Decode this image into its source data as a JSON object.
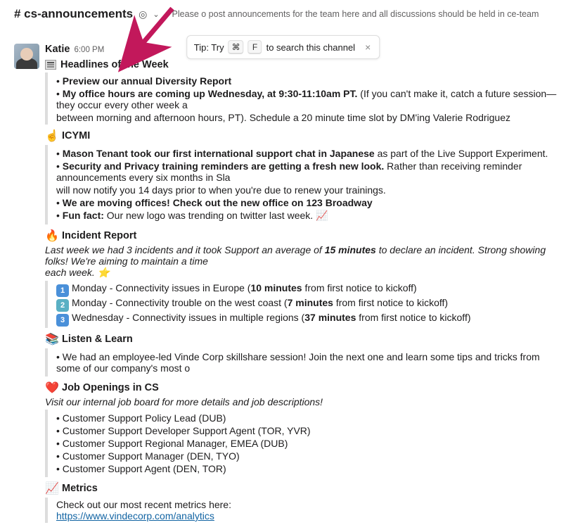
{
  "header": {
    "channel_name": "# cs-announcements",
    "topic": "Please o       post announcements for the team here and all discussions should be held in ce-team"
  },
  "tip": {
    "prefix": "Tip: Try",
    "key1": "⌘",
    "key2": "F",
    "suffix": "to search this channel"
  },
  "message": {
    "sender": "Katie",
    "time": "6:00 PM",
    "headlines": {
      "title": "Headlines of the Week",
      "b1_bold": "Preview our annual Diversity Report",
      "b2_bold": "My office hours are coming up Wednesday, at 9:30-11:10am PT.",
      "b2_rest": " (If you can't make it, catch a future session—they occur every other week a",
      "b2_line2": "between morning and afternoon hours, PT). Schedule a 20 minute time slot by DM'ing Valerie Rodriguez"
    },
    "icymi": {
      "title": "ICYMI",
      "b1_bold": "Mason Tenant took our first international support chat in Japanese",
      "b1_rest": " as part of the Live Support Experiment.",
      "b2_bold": "Security and Privacy training reminders are getting a fresh new look.",
      "b2_rest": " Rather than receiving reminder announcements every six months in Sla",
      "b2_line2": "will now notify you 14 days prior to when you're due to renew your trainings.",
      "b3_bold": "We are moving offices! Check out the new office on 123 Broadway",
      "b4_bold": "Fun fact:",
      "b4_rest": " Our new logo was trending on twitter last week. 📈"
    },
    "incident": {
      "title": "Incident Report",
      "intro_a": "Last week we had 3 incidents and it took Support an average of ",
      "intro_bold": "15 minutes",
      "intro_b": " to declare an incident. Strong showing folks! We're aiming to maintain a time",
      "intro_c": "each week. ⭐",
      "r1_day": "Monday - Connectivity issues in Europe (",
      "r1_bold": "10 minutes",
      "r1_rest": " from first notice to kickoff)",
      "r2_day": "Monday - Connectivity trouble on the west coast (",
      "r2_bold": "7 minutes",
      "r2_rest": " from first notice to kickoff)",
      "r3_day": "Wednesday - Connectivity issues in multiple regions (",
      "r3_bold": "37 minutes",
      "r3_rest": " from first notice to kickoff)"
    },
    "listen": {
      "title": "Listen & Learn",
      "b1": "We had an employee-led Vinde Corp skillshare session! Join the next one and learn some tips and tricks from some of our company's most o"
    },
    "jobs": {
      "title": "Job Openings in CS",
      "intro": "Visit our internal job board for more details and job descriptions!",
      "j1": "Customer Support Policy Lead (DUB)",
      "j2": "Customer Support Developer Support Agent (TOR, YVR)",
      "j3": "Customer Support Regional Manager, EMEA (DUB)",
      "j4": "Customer Support Manager (DEN, TYO)",
      "j5": "Customer Support Agent (DEN, TOR)"
    },
    "metrics": {
      "title": "Metrics",
      "intro": "Check out our most recent metrics here:",
      "link": "https://www.vindecorp.com/analytics"
    }
  }
}
